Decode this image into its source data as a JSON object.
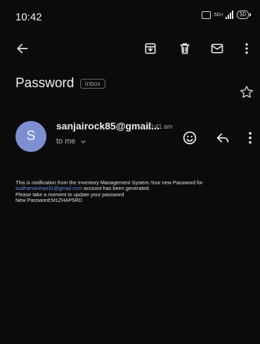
{
  "status_bar": {
    "time": "10:42",
    "network_label": "5G+",
    "battery": "50"
  },
  "toolbar": {
    "back_icon": "arrow-left-icon",
    "archive_icon": "archive-icon",
    "delete_icon": "trash-icon",
    "mark_unread_icon": "mail-icon",
    "more_icon": "more-vert-icon"
  },
  "email": {
    "subject": "Password",
    "label": "Inbox",
    "sender": {
      "avatar_letter": "S",
      "avatar_color": "#7d8fd1",
      "address": "sanjairock85@gmail...",
      "time": "10:41 am",
      "to": "to me"
    },
    "body": {
      "line1": "This is notification from the Inventory Management System.Your new Password for",
      "link": "sudharsanhari31@gmail.com",
      "line2_rest": " account has been generated.",
      "line3": "Please take a moment to update your password",
      "line4": "New Password:M1ZHAP5RD"
    }
  },
  "colors": {
    "background": "#0b0b0c",
    "link": "#6f8fe0"
  }
}
